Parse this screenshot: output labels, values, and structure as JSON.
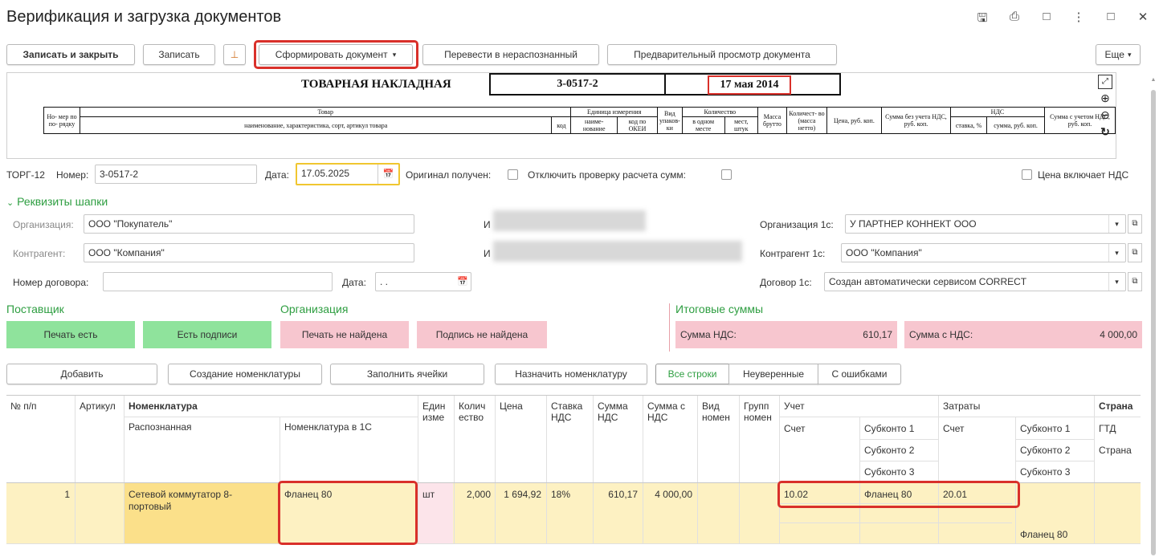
{
  "window": {
    "title": "Верификация и загрузка документов"
  },
  "toolbar": {
    "save_close": "Записать и закрыть",
    "save": "Записать",
    "generate": "Сформировать документ",
    "unrecognized": "Перевести в нераспознанный",
    "preview": "Предварительный просмотр документа",
    "more": "Еще"
  },
  "doc_preview": {
    "title": "ТОВАРНАЯ НАКЛАДНАЯ",
    "number": "3-0517-2",
    "date": "17 мая 2014",
    "headers": {
      "num": "Но- мер по по- рядку",
      "goods": "Товар",
      "goods_sub": "наименование, характеристика, сорт, артикул товара",
      "code": "код",
      "unit": "Единица измерения",
      "unit_name": "наиме- нование",
      "unit_okei": "код по ОКЕИ",
      "pack": "Вид упаков- ки",
      "qty": "Количество",
      "qty_place": "в одном месте",
      "qty_places": "мест, штук",
      "mass": "Масса брутто",
      "qty_net": "Количест- во (масса нетто)",
      "price": "Цена, руб. коп.",
      "sum_no_vat": "Сумма без учета НДС, руб. коп.",
      "vat": "НДС",
      "vat_rate": "ставка, %",
      "vat_sum": "сумма, руб. коп.",
      "sum_vat": "Сумма с учетом НДС, руб. коп."
    }
  },
  "form": {
    "torg": "ТОРГ-12",
    "number_label": "Номер:",
    "number_value": "3-0517-2",
    "date_label": "Дата:",
    "date_value": "17.05.2025",
    "orig_label": "Оригинал получен:",
    "disable_check_label": "Отключить проверку расчета сумм:",
    "price_vat_label": "Цена включает НДС",
    "header_section": "Реквизиты шапки",
    "org_label": "Организация:",
    "org_value": "ООО \"Покупатель\"",
    "contr_label": "Контрагент:",
    "contr_value": "ООО \"Компания\"",
    "contract_label": "Номер договора:",
    "contract_date_label": "Дата:",
    "contract_date_value": ". .",
    "inn1_prefix": "И",
    "inn2_prefix": "И",
    "org1c_label": "Организация 1с:",
    "org1c_value": "У ПАРТНЕР КОННЕКТ ООО",
    "contr1c_label": "Контрагент 1с:",
    "contr1c_value": "ООО \"Компания\"",
    "contract1c_label": "Договор 1с:",
    "contract1c_value": "Создан автоматически сервисом CORRECT"
  },
  "sections": {
    "supplier": "Поставщик",
    "organization": "Организация",
    "totals": "Итоговые суммы"
  },
  "tiles": {
    "stamp_yes": "Печать есть",
    "sign_yes": "Есть подписи",
    "stamp_no": "Печать не найдена",
    "sign_no": "Подпись не найдена",
    "vat_sum_label": "Сумма НДС:",
    "vat_sum_value": "610,17",
    "total_label": "Сумма с НДС:",
    "total_value": "4 000,00"
  },
  "actions": {
    "add": "Добавить",
    "create_nom": "Создание номенклатуры",
    "fill": "Заполнить ячейки",
    "assign": "Назначить номенклатуру",
    "all_rows": "Все строки",
    "uncertain": "Неуверенные",
    "errors": "С ошибками"
  },
  "grid": {
    "h_num": "№ п/п",
    "h_art": "Артикул",
    "h_nom": "Номенклатура",
    "h_recognized": "Распознанная",
    "h_nom1c": "Номенклатура в 1С",
    "h_unit": "Единизме",
    "h_qty": "Количество",
    "h_price": "Цена",
    "h_rate": "Ставка НДС",
    "h_vatsum": "Сумма НДС",
    "h_sumvat": "Сумма с НДС",
    "h_kind": "Вид номен",
    "h_group": "Групп номен",
    "h_acc": "Учет",
    "h_acc_account": "Счет",
    "h_sub1": "Субконто 1",
    "h_sub2": "Субконто 2",
    "h_sub3": "Субконто 3",
    "h_cost": "Затраты",
    "h_cost_account": "Счет",
    "h_csub1": "Субконто 1",
    "h_csub2": "Субконто 2",
    "h_csub3": "Субконто 3",
    "h_country": "Страна",
    "h_gtd": "ГТД",
    "h_country2": "Страна",
    "row": {
      "num": "1",
      "recognized": "Сетевой коммутатор 8-портовый",
      "nom1c": "Фланец 80",
      "unit": "шт",
      "qty": "2,000",
      "price": "1 694,92",
      "rate": "18%",
      "vat": "610,17",
      "sum": "4 000,00",
      "acc": "10.02",
      "sub1": "Фланец 80",
      "cost_acc": "20.01",
      "csub3": "Фланец 80"
    }
  }
}
